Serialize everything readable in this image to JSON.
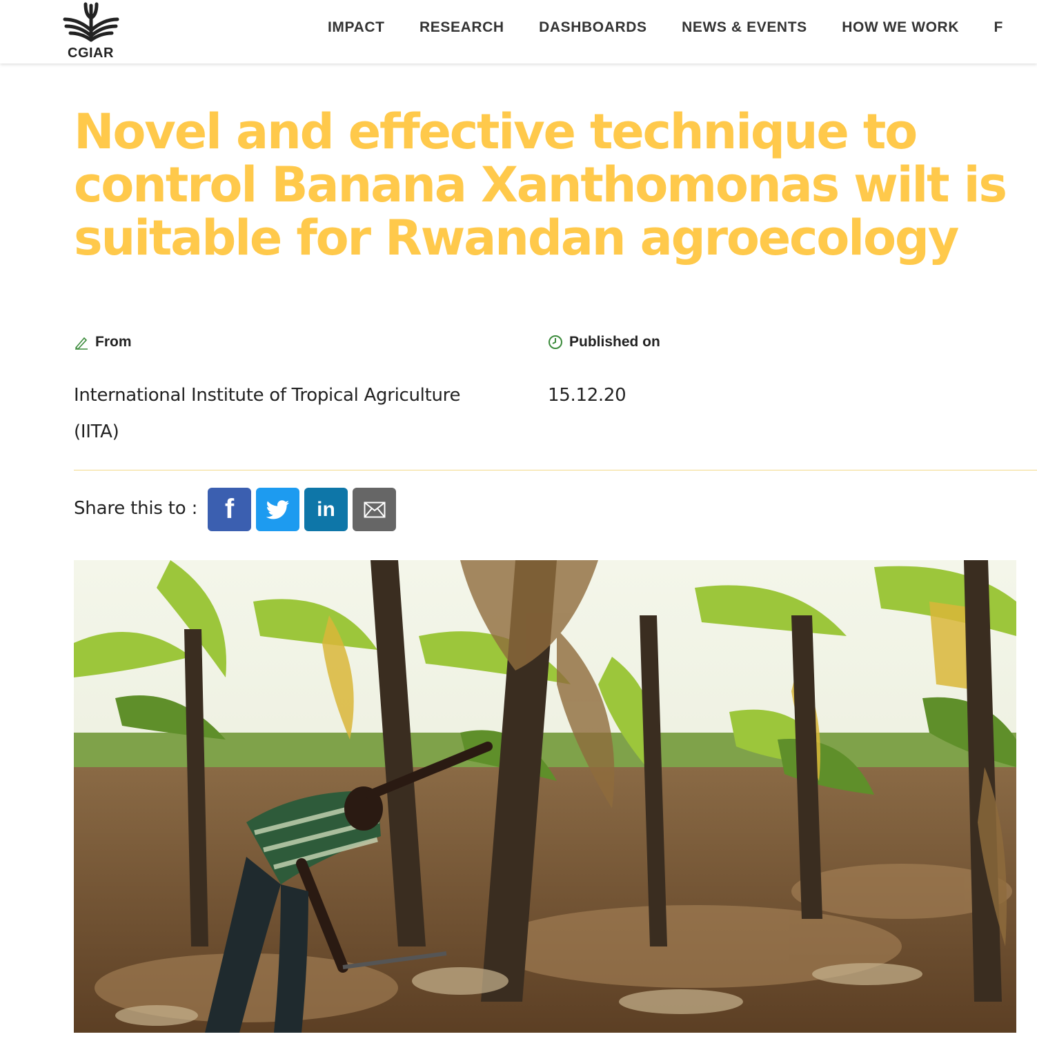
{
  "brand": {
    "logo_text": "CGIAR"
  },
  "nav": {
    "items": [
      "IMPACT",
      "RESEARCH",
      "DASHBOARDS",
      "NEWS & EVENTS",
      "HOW WE WORK",
      "F"
    ]
  },
  "article": {
    "title": "Novel and effective technique to control Banana Xanthomonas wilt is suitable for Rwandan agroecology",
    "from_label": "From",
    "from_value": "International Institute of Tropical Agriculture (IITA)",
    "published_label": "Published on",
    "published_value": "15.12.20"
  },
  "share": {
    "label": "Share this to :",
    "buttons": [
      {
        "icon": "facebook-icon",
        "color": "#3b5fb0"
      },
      {
        "icon": "twitter-icon",
        "color": "#1d9bf0"
      },
      {
        "icon": "linkedin-icon",
        "color": "#0e76a8"
      },
      {
        "icon": "email-icon",
        "color": "#666666"
      }
    ]
  },
  "colors": {
    "title": "#ffc94b",
    "meta_icon": "#3a8a3a",
    "divider": "#f3d98a"
  }
}
